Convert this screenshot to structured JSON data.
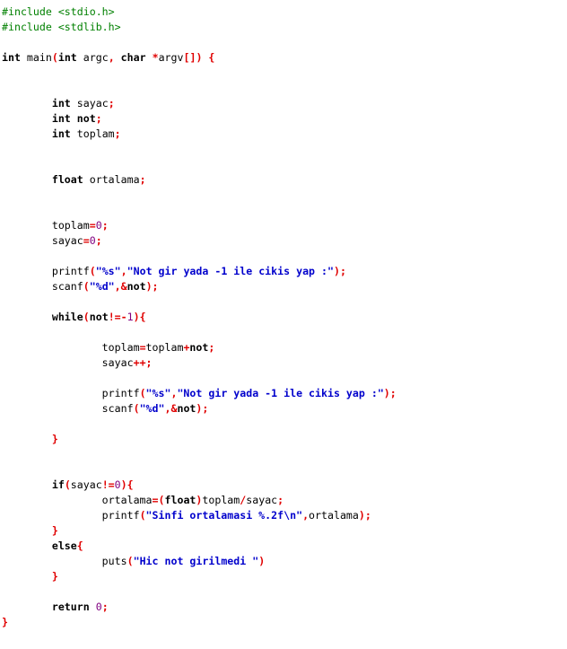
{
  "editor": {
    "language": "C",
    "colors": {
      "preprocessor": "#008000",
      "keyword": "#000000",
      "operator": "#e00000",
      "number": "#800080",
      "string": "#0000cc",
      "identifier": "#000000"
    },
    "lines": [
      [
        [
          "pp",
          "#include <stdio.h>"
        ]
      ],
      [
        [
          "pp",
          "#include <stdlib.h>"
        ]
      ],
      [],
      [
        [
          "kw",
          "int"
        ],
        [
          "id",
          " main"
        ],
        [
          "op",
          "("
        ],
        [
          "kw",
          "int"
        ],
        [
          "id",
          " argc"
        ],
        [
          "op",
          ","
        ],
        [
          "id",
          " "
        ],
        [
          "kw",
          "char"
        ],
        [
          "id",
          " "
        ],
        [
          "op",
          "*"
        ],
        [
          "id",
          "argv"
        ],
        [
          "op",
          "[])"
        ],
        [
          "id",
          " "
        ],
        [
          "op",
          "{"
        ]
      ],
      [],
      [],
      [
        [
          "id",
          "        "
        ],
        [
          "kw",
          "int"
        ],
        [
          "id",
          " sayac"
        ],
        [
          "op",
          ";"
        ]
      ],
      [
        [
          "id",
          "        "
        ],
        [
          "kw",
          "int"
        ],
        [
          "id",
          " "
        ],
        [
          "kw",
          "not"
        ],
        [
          "op",
          ";"
        ]
      ],
      [
        [
          "id",
          "        "
        ],
        [
          "kw",
          "int"
        ],
        [
          "id",
          " toplam"
        ],
        [
          "op",
          ";"
        ]
      ],
      [],
      [],
      [
        [
          "id",
          "        "
        ],
        [
          "kw",
          "float"
        ],
        [
          "id",
          " ortalama"
        ],
        [
          "op",
          ";"
        ]
      ],
      [],
      [],
      [
        [
          "id",
          "        toplam"
        ],
        [
          "op",
          "="
        ],
        [
          "num",
          "0"
        ],
        [
          "op",
          ";"
        ]
      ],
      [
        [
          "id",
          "        sayac"
        ],
        [
          "op",
          "="
        ],
        [
          "num",
          "0"
        ],
        [
          "op",
          ";"
        ]
      ],
      [],
      [
        [
          "id",
          "        printf"
        ],
        [
          "op",
          "("
        ],
        [
          "str",
          "\"%s\""
        ],
        [
          "op",
          ","
        ],
        [
          "str",
          "\"Not gir yada -1 ile cikis yap :\""
        ],
        [
          "op",
          ");"
        ]
      ],
      [
        [
          "id",
          "        scanf"
        ],
        [
          "op",
          "("
        ],
        [
          "str",
          "\"%d\""
        ],
        [
          "op",
          ",&"
        ],
        [
          "kw",
          "not"
        ],
        [
          "op",
          ");"
        ]
      ],
      [],
      [
        [
          "id",
          "        "
        ],
        [
          "kw",
          "while"
        ],
        [
          "op",
          "("
        ],
        [
          "kw",
          "not"
        ],
        [
          "op",
          "!=-"
        ],
        [
          "num",
          "1"
        ],
        [
          "op",
          "){"
        ]
      ],
      [],
      [
        [
          "id",
          "                toplam"
        ],
        [
          "op",
          "="
        ],
        [
          "id",
          "toplam"
        ],
        [
          "op",
          "+"
        ],
        [
          "kw",
          "not"
        ],
        [
          "op",
          ";"
        ]
      ],
      [
        [
          "id",
          "                sayac"
        ],
        [
          "op",
          "++;"
        ]
      ],
      [],
      [
        [
          "id",
          "                printf"
        ],
        [
          "op",
          "("
        ],
        [
          "str",
          "\"%s\""
        ],
        [
          "op",
          ","
        ],
        [
          "str",
          "\"Not gir yada -1 ile cikis yap :\""
        ],
        [
          "op",
          ");"
        ]
      ],
      [
        [
          "id",
          "                scanf"
        ],
        [
          "op",
          "("
        ],
        [
          "str",
          "\"%d\""
        ],
        [
          "op",
          ",&"
        ],
        [
          "kw",
          "not"
        ],
        [
          "op",
          ");"
        ]
      ],
      [],
      [
        [
          "id",
          "        "
        ],
        [
          "op",
          "}"
        ]
      ],
      [],
      [],
      [
        [
          "id",
          "        "
        ],
        [
          "kw",
          "if"
        ],
        [
          "op",
          "("
        ],
        [
          "id",
          "sayac"
        ],
        [
          "op",
          "!="
        ],
        [
          "num",
          "0"
        ],
        [
          "op",
          "){"
        ]
      ],
      [
        [
          "id",
          "                ortalama"
        ],
        [
          "op",
          "=("
        ],
        [
          "kw",
          "float"
        ],
        [
          "op",
          ")"
        ],
        [
          "id",
          "toplam"
        ],
        [
          "op",
          "/"
        ],
        [
          "id",
          "sayac"
        ],
        [
          "op",
          ";"
        ]
      ],
      [
        [
          "id",
          "                printf"
        ],
        [
          "op",
          "("
        ],
        [
          "str",
          "\"Sinfi ortalamasi %.2f\\n\""
        ],
        [
          "op",
          ","
        ],
        [
          "id",
          "ortalama"
        ],
        [
          "op",
          ");"
        ]
      ],
      [
        [
          "id",
          "        "
        ],
        [
          "op",
          "}"
        ]
      ],
      [
        [
          "id",
          "        "
        ],
        [
          "kw",
          "else"
        ],
        [
          "op",
          "{"
        ]
      ],
      [
        [
          "id",
          "                puts"
        ],
        [
          "op",
          "("
        ],
        [
          "str",
          "\"Hic not girilmedi \""
        ],
        [
          "op",
          ")"
        ]
      ],
      [
        [
          "id",
          "        "
        ],
        [
          "op",
          "}"
        ]
      ],
      [],
      [
        [
          "id",
          "        "
        ],
        [
          "kw",
          "return"
        ],
        [
          "id",
          " "
        ],
        [
          "num",
          "0"
        ],
        [
          "op",
          ";"
        ]
      ],
      [
        [
          "op",
          "}"
        ]
      ]
    ]
  }
}
